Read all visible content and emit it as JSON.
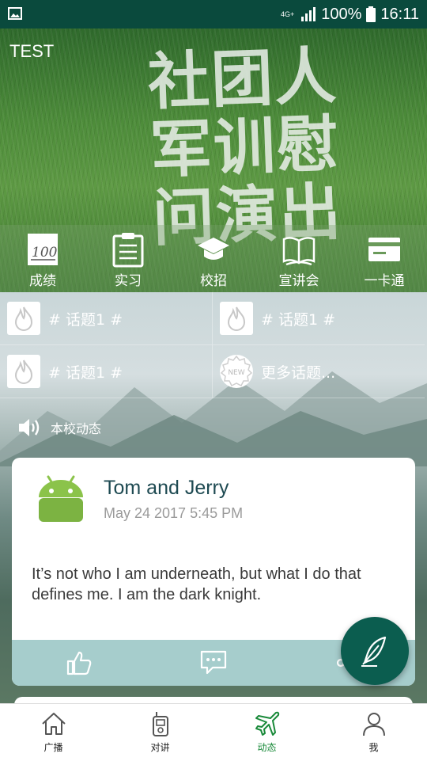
{
  "status_bar": {
    "network": "4G+",
    "battery": "100%",
    "time": "16:11"
  },
  "app_title": "TEST",
  "banner": {
    "poster_text": "社团人\n军训慰\n问演出"
  },
  "menu": [
    {
      "label": "成绩",
      "icon": "score-icon"
    },
    {
      "label": "实习",
      "icon": "clipboard-icon"
    },
    {
      "label": "校招",
      "icon": "graduation-cap-icon"
    },
    {
      "label": "宣讲会",
      "icon": "open-book-icon"
    },
    {
      "label": "一卡通",
      "icon": "card-icon"
    }
  ],
  "topics": [
    {
      "label": "# 话题1 #",
      "icon": "flame-icon"
    },
    {
      "label": "# 话题1 #",
      "icon": "flame-icon"
    },
    {
      "label": "# 话题1 #",
      "icon": "flame-icon"
    },
    {
      "label": "更多话题...",
      "icon": "new-badge-icon"
    }
  ],
  "news_section": {
    "label": "本校动态",
    "icon": "speaker-icon"
  },
  "post": {
    "author": "Tom and Jerry",
    "time": "May 24 2017 5:45 PM",
    "text": "It’s not who I am underneath, but what I do that defines me. I am the dark knight.",
    "actions": [
      "thumbs-up-icon",
      "comment-icon",
      "share-icon"
    ]
  },
  "fab": {
    "icon": "feather-pen-icon"
  },
  "bottom_nav": [
    {
      "label": "广播",
      "icon": "home-icon",
      "active": false
    },
    {
      "label": "对讲",
      "icon": "walkie-talkie-icon",
      "active": false
    },
    {
      "label": "动态",
      "icon": "plane-icon",
      "active": true
    },
    {
      "label": "我",
      "icon": "person-icon",
      "active": false
    }
  ],
  "colors": {
    "status_bar": "#0a4a3d",
    "accent": "#0b5d4f",
    "active_nav": "#1a8a3a",
    "card_actions": "#a6cdcc"
  }
}
